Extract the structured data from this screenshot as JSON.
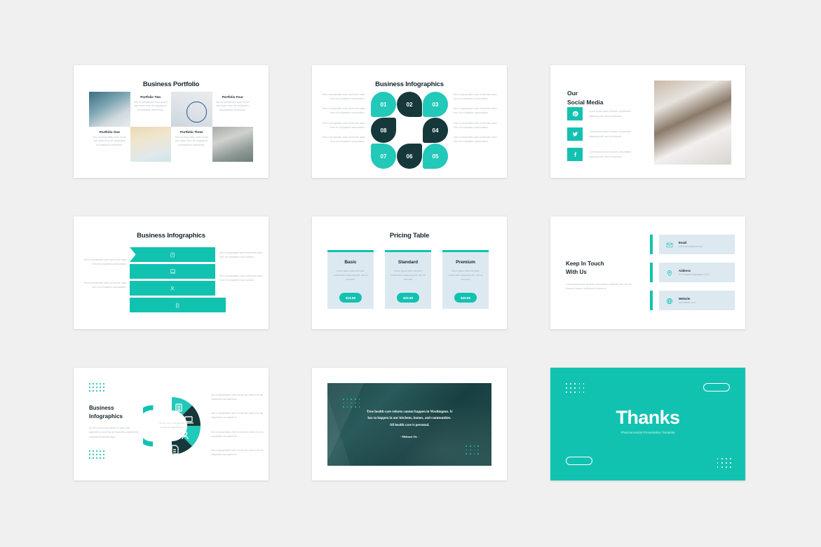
{
  "theme": {
    "teal": "#12c2b0",
    "dark": "#16383a",
    "navy": "#16262e",
    "muted": "#b9c0c4",
    "card_blue": "#dde9f1",
    "background": "#f0f0f0"
  },
  "slides": {
    "portfolio": {
      "title": "Business Portfolio",
      "items": [
        {
          "name": "Portfolio One",
          "body": "Sed ut perspiciatis unde omnis iste natus error sit voluptatem accusantium doloremqu."
        },
        {
          "name": "Portfolio Two",
          "body": "Sed ut perspiciatis unde omnis iste natus error sit voluptatem accusantium doloremqu."
        },
        {
          "name": "Portfolio Three",
          "body": "Sed ut perspiciatis unde omnis iste natus error sit voluptatem accusantium doloremqu."
        },
        {
          "name": "Portfolio Four",
          "body": "Sed ut perspiciatis unde omnis iste natus error sit voluptatem accusantium doloremqu."
        }
      ],
      "images": [
        "surgery-photo",
        "stethoscope-photo",
        "pills-photo",
        "doctor-photo"
      ]
    },
    "petals": {
      "title": "Business Infographics",
      "numbers": [
        "01",
        "02",
        "03",
        "04",
        "05",
        "06",
        "07",
        "08"
      ],
      "left_texts": [
        "Sed ut perspiciatis unde omnis iste natus error sit voluptatem accusantium.",
        "Sed ut perspiciatis unde omnis iste natus error sit voluptatem accusantium.",
        "Sed ut perspiciatis unde omnis iste natus error sit voluptatem accusantium.",
        "Sed ut perspiciatis unde omnis iste natus error sit voluptatem accusantium."
      ],
      "right_texts": [
        "Sed ut perspiciatis unde omnis iste natus error sit voluptatem accusantium.",
        "Sed ut perspiciatis unde omnis iste natus error sit voluptatem accusantium.",
        "Sed ut perspiciatis unde omnis iste natus error sit voluptatem accusantium.",
        "Sed ut perspiciatis unde omnis iste natus error sit voluptatem accusantium."
      ]
    },
    "social": {
      "title_line1": "Our",
      "title_line2": "Social Media",
      "rows": [
        {
          "icon": "pinterest-icon",
          "text": "Lorem ipsum dolor sit amet, consectetur adipiscing elit, sed do eiusmod."
        },
        {
          "icon": "twitter-icon",
          "text": "Lorem ipsum dolor sit amet, consectetur adipiscing elit, sed do eiusmod."
        },
        {
          "icon": "facebook-icon",
          "text": "Lorem ipsum dolor sit amet, consectetur adipiscing elit, sed do eiusmod."
        }
      ],
      "image": "dental-chair-photo"
    },
    "ribbons": {
      "title": "Business Infographics",
      "icons": [
        "clipboard-icon",
        "laptop-icon",
        "person-icon",
        "document-icon"
      ],
      "left_texts": [
        "Sed ut perspiciatis unde omnis iste natus error sit voluptatem accusantium.",
        "Sed ut perspiciatis unde omnis iste natus error sit voluptatem accusantium."
      ],
      "right_texts": [
        "Sed ut perspiciatis unde omnis iste natus error sit voluptatem accusantium.",
        "Sed ut perspiciatis unde omnis iste natus error sit voluptatem accusantium."
      ]
    },
    "pricing": {
      "title": "Pricing Table",
      "plans": [
        {
          "name": "Basic",
          "body": "Lorem ipsum dolor sit amet, consectetur adipiscing elit, sed do eiusmod",
          "price": "$19.99"
        },
        {
          "name": "Standard",
          "body": "Lorem ipsum dolor sit amet, consectetur adipiscing elit, sed do eiusmod",
          "price": "$29.99"
        },
        {
          "name": "Premium",
          "body": "Lorem ipsum dolor sit amet, consectetur adipiscing elit, sed do eiusmod",
          "price": "$39.99"
        }
      ]
    },
    "contact": {
      "title_line1": "Keep In Touch",
      "title_line2": "With Us",
      "body": "Lorem ipsum dolor sit amet, consectetur adipiscing elit, sed do eiusmod tempor incididunt ut labore et.",
      "rows": [
        {
          "icon": "envelope-icon",
          "label": "Email",
          "value": "yourbestmail@mail.com"
        },
        {
          "icon": "location-pin-icon",
          "label": "Address",
          "value": "St. Postgate Obyonagoro 4237"
        },
        {
          "icon": "globe-icon",
          "label": "Website",
          "value": "yourwebsite.com"
        }
      ]
    },
    "donut": {
      "title_line1": "Business",
      "title_line2": "Infographics",
      "body": "At vero eos et accusamus et iusto odio dignissimos ducimus qui blanditiis praesentium voluptatum deleniti atque.",
      "center_text": "At vero eos et accusamus et iusto odio dignissimos.",
      "icons": [
        "clipboard-icon",
        "laptop-icon",
        "person-icon",
        "document-icon"
      ],
      "right_texts": [
        "Sed ut perspiciatis unde omnis iste natus error sit voluptatem accusantium.",
        "Sed ut perspiciatis unde omnis iste natus error sit voluptatem accusantium.",
        "Sed ut perspiciatis unde omnis iste natus error sit voluptatem accusantium.",
        "Sed ut perspiciatis unde omnis iste natus error sit voluptatem accusantium."
      ]
    },
    "quote": {
      "line1": "True health care reform cannot happen in Washington. It",
      "line2": "has to happen in our kitchens, homes, and communities.",
      "line3": "All health care is personal.",
      "author": "- Mehmet Oz -",
      "image": "desk-pens-photo"
    },
    "thanks": {
      "title": "Thanks",
      "subtitle": "Pharmaceutical Presentation Template"
    }
  }
}
